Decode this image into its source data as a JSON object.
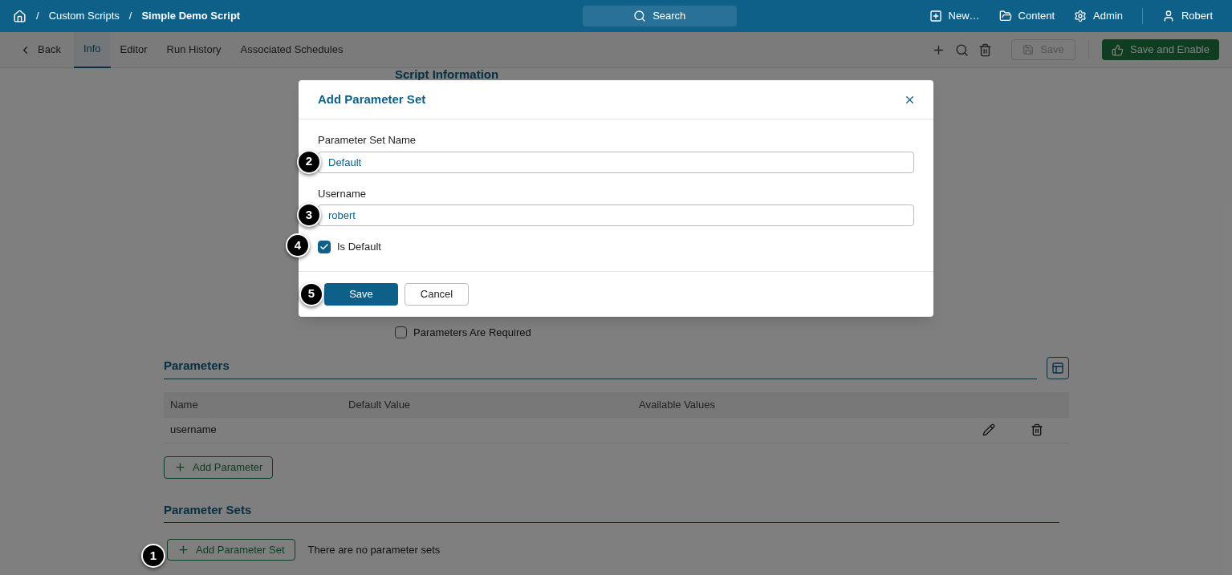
{
  "breadcrumb": [
    {
      "separator": "/",
      "label": "Custom Scripts",
      "current": false
    },
    {
      "separator": "/",
      "label": "Simple Demo Script",
      "current": true
    }
  ],
  "topbar": {
    "search": "Search",
    "actions": [
      {
        "kind": "new",
        "label": "New…"
      },
      {
        "kind": "content",
        "label": "Content"
      },
      {
        "kind": "admin",
        "label": "Admin"
      }
    ],
    "user": "Robert"
  },
  "subnav": {
    "back": "Back",
    "tabs": [
      {
        "label": "Info",
        "selected": true
      },
      {
        "label": "Editor",
        "selected": false
      },
      {
        "label": "Run History",
        "selected": false
      },
      {
        "label": "Associated Schedules",
        "selected": false
      }
    ],
    "save": {
      "label": "Save",
      "disabled": true
    },
    "save_enable": "Save and Enable"
  },
  "page": {
    "script_information": "Script Information",
    "parameters_required": {
      "label": "Parameters Are Required",
      "checked": false
    },
    "parameters": {
      "title": "Parameters",
      "columns": [
        "Name",
        "Default Value",
        "Available Values"
      ],
      "rows": [
        {
          "name": "username"
        }
      ],
      "add": "Add Parameter"
    },
    "parameter_sets": {
      "title": "Parameter Sets",
      "add": {
        "label": "Add Parameter Set",
        "callout": "1"
      },
      "empty": "There are no parameter sets"
    }
  },
  "dialog": {
    "title": "Add Parameter Set",
    "fields": [
      {
        "label": "Parameter Set Name",
        "value": "Default",
        "callout": "2"
      },
      {
        "label": "Username",
        "value": "robert",
        "callout": "3"
      }
    ],
    "is_default": {
      "label": "Is Default",
      "checked": true,
      "callout": "4"
    },
    "buttons": [
      {
        "label": "Save",
        "kind": "primary",
        "callout": "5"
      },
      {
        "label": "Cancel",
        "kind": "secondary"
      }
    ]
  }
}
